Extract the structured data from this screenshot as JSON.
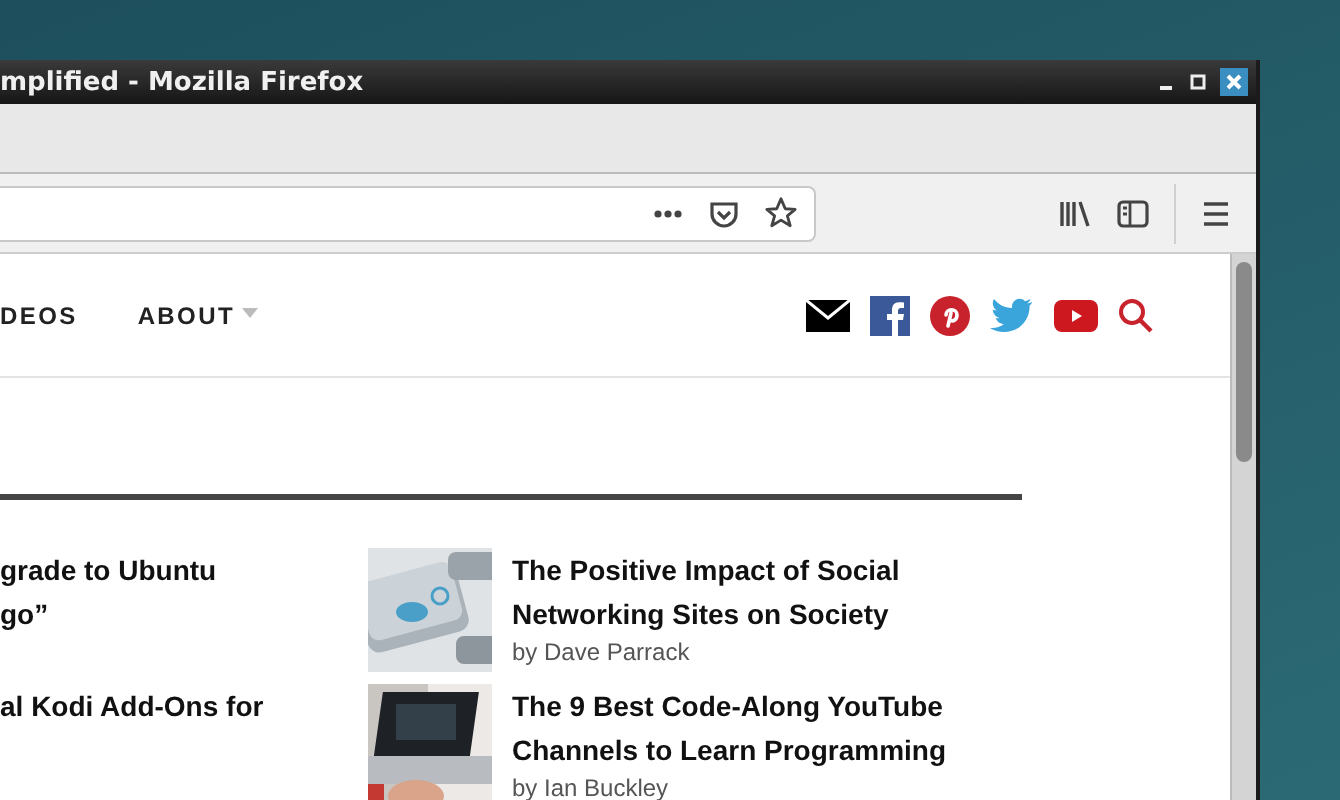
{
  "window": {
    "title": "mplified - Mozilla Firefox"
  },
  "nav": {
    "items": [
      {
        "label": "DEOS",
        "has_dropdown": false
      },
      {
        "label": "ABOUT",
        "has_dropdown": true
      }
    ]
  },
  "articles_left": [
    {
      "title": "grade to Ubuntu\ngo”"
    },
    {
      "title": "al Kodi Add-Ons for"
    }
  ],
  "articles_right": [
    {
      "title": "The Positive Impact of Social Networking Sites on Society",
      "author": "by Dave Parrack"
    },
    {
      "title": "The 9 Best Code-Along YouTube Channels to Learn Programming",
      "author": "by Ian Buckley"
    }
  ]
}
